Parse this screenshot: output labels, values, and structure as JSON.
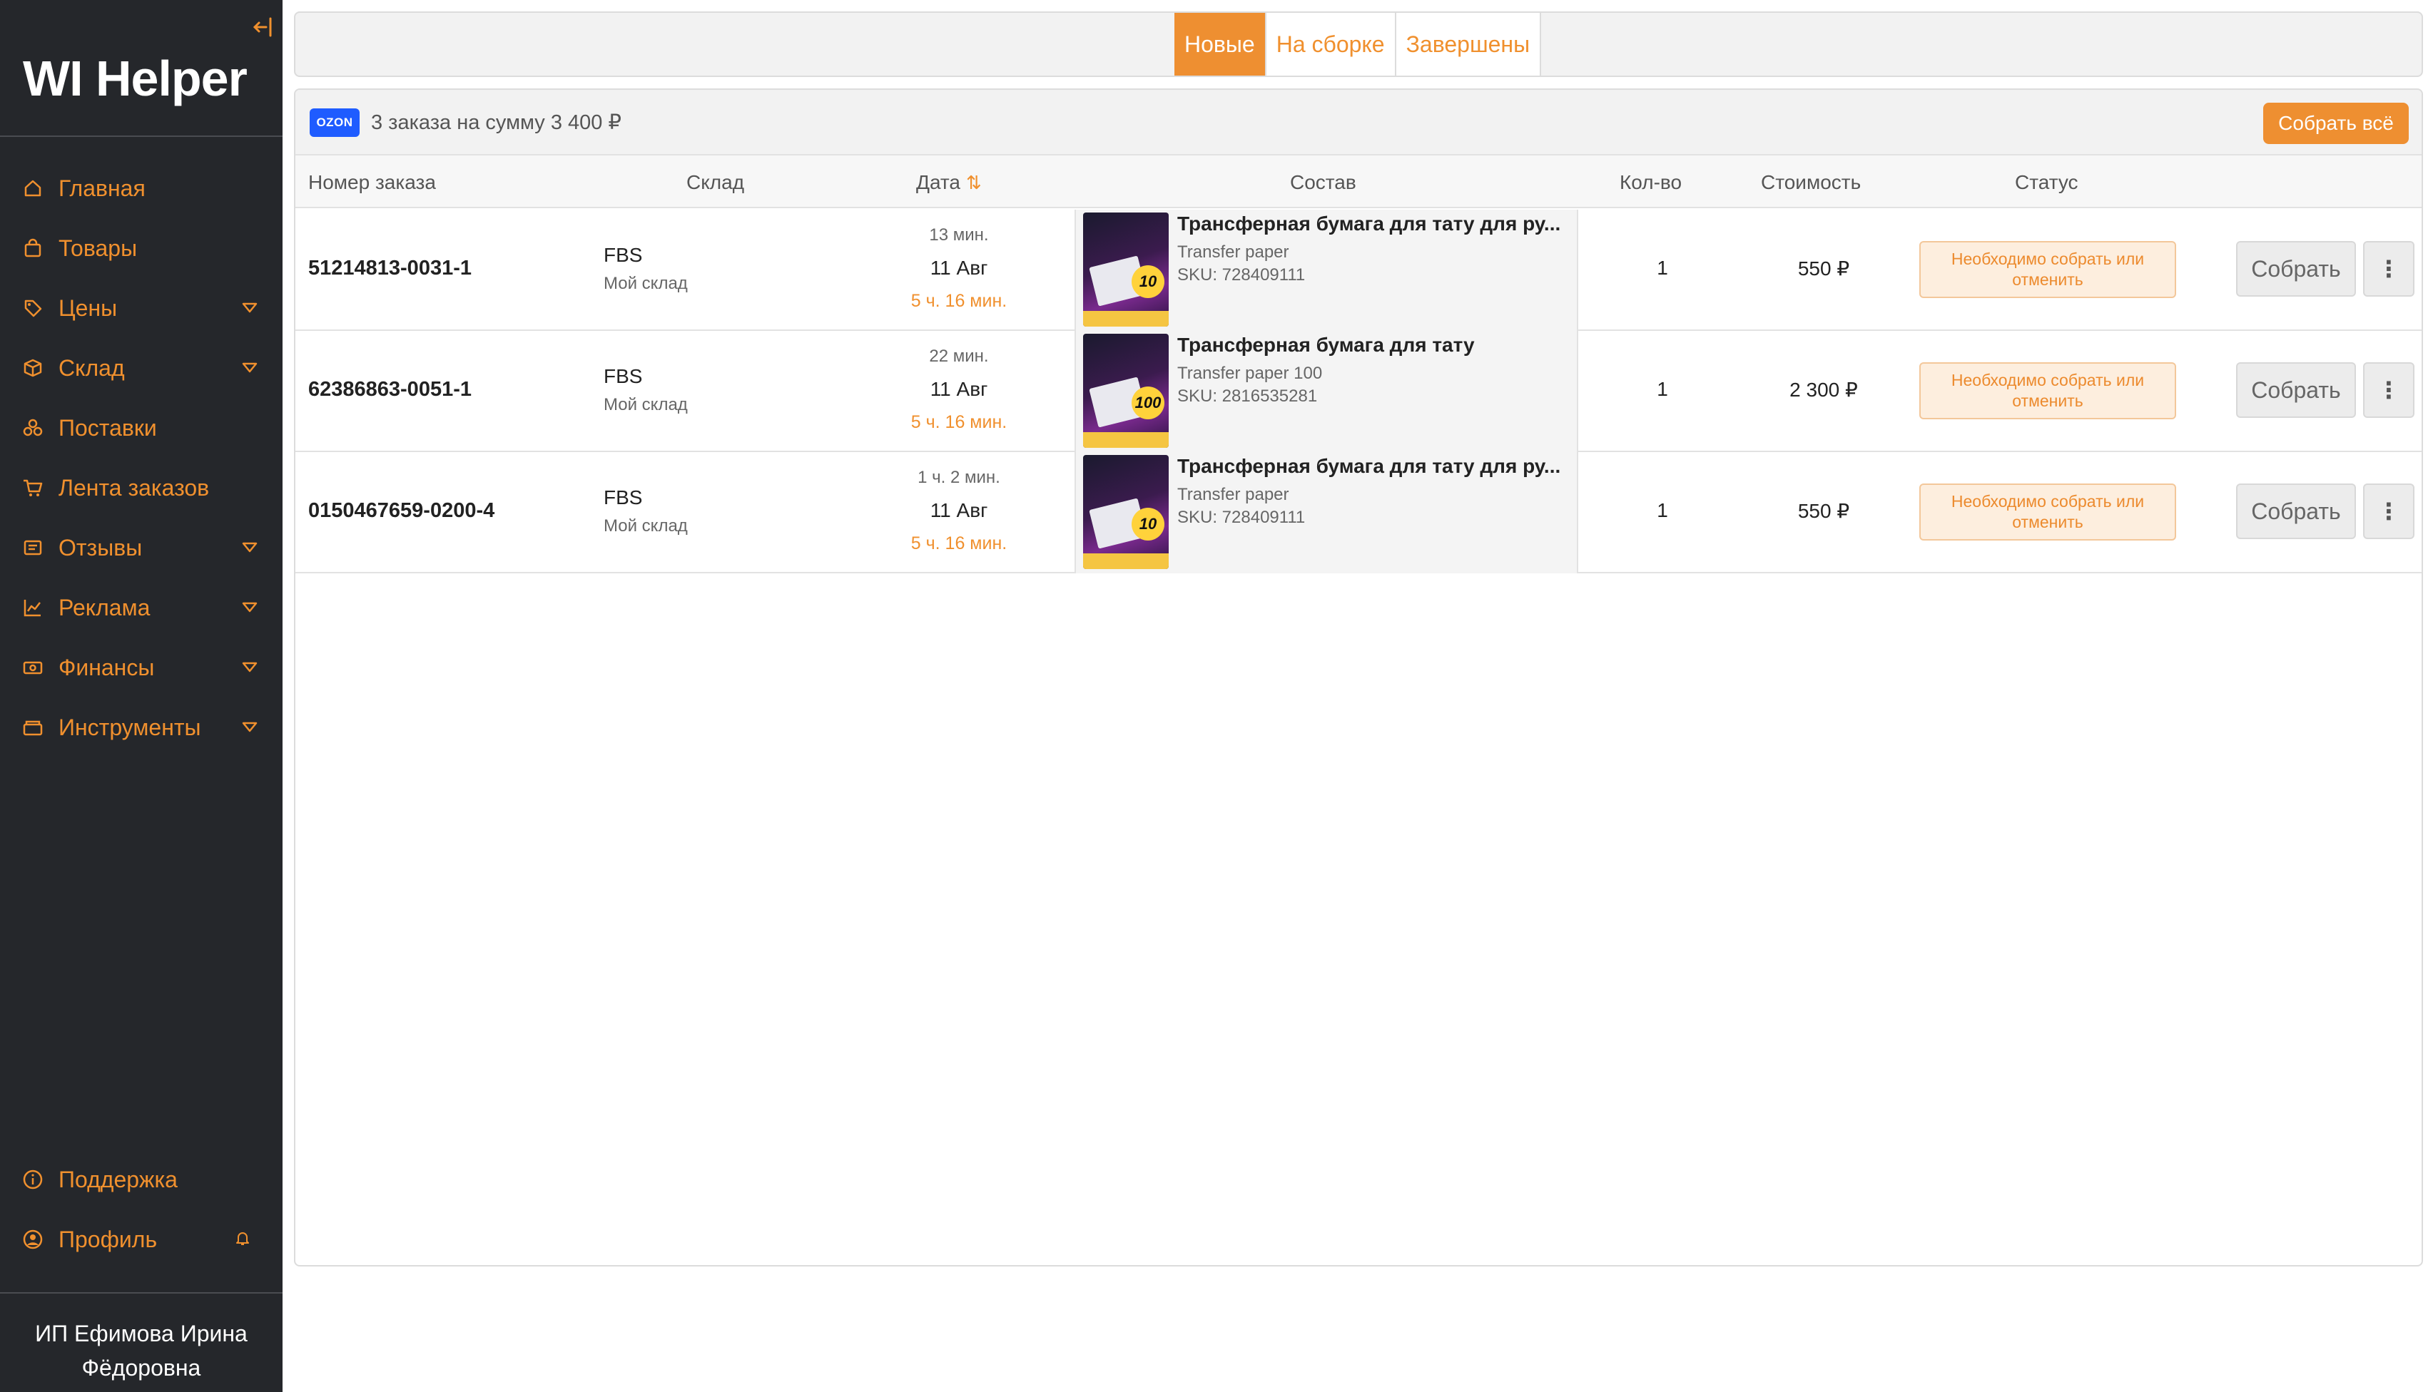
{
  "app": {
    "logo": "WI Helper",
    "collapse_icon": "collapse-left-icon"
  },
  "sidebar": {
    "items": [
      {
        "label": "Главная",
        "icon": "home-icon",
        "has_submenu": false
      },
      {
        "label": "Товары",
        "icon": "bag-icon",
        "has_submenu": false
      },
      {
        "label": "Цены",
        "icon": "tag-icon",
        "has_submenu": true
      },
      {
        "label": "Склад",
        "icon": "box-icon",
        "has_submenu": true
      },
      {
        "label": "Поставки",
        "icon": "boxes-icon",
        "has_submenu": false
      },
      {
        "label": "Лента заказов",
        "icon": "cart-icon",
        "has_submenu": false
      },
      {
        "label": "Отзывы",
        "icon": "reviews-icon",
        "has_submenu": true
      },
      {
        "label": "Реклама",
        "icon": "chart-line-icon",
        "has_submenu": true
      },
      {
        "label": "Финансы",
        "icon": "money-icon",
        "has_submenu": true
      },
      {
        "label": "Инструменты",
        "icon": "tools-icon",
        "has_submenu": true
      }
    ],
    "bottom_items": [
      {
        "label": "Поддержка",
        "icon": "info-icon"
      },
      {
        "label": "Профиль",
        "icon": "user-circle-icon"
      }
    ],
    "user_name": "ИП Ефимова Ирина Фёдоровна"
  },
  "tabs": [
    {
      "label": "Новые",
      "active": true
    },
    {
      "label": "На сборке",
      "active": false
    },
    {
      "label": "Завершены",
      "active": false
    }
  ],
  "panel": {
    "marketplace_badge": "OZON",
    "summary": "3 заказа на сумму 3 400 ₽",
    "collect_all_label": "Собрать всё"
  },
  "columns": {
    "order_no": "Номер заказа",
    "warehouse": "Склад",
    "date": "Дата",
    "composition": "Состав",
    "qty": "Кол-во",
    "cost": "Стоимость",
    "status": "Статус"
  },
  "orders": [
    {
      "order_no": "51214813-0031-1",
      "wh_type": "FBS",
      "wh_name": "Мой склад",
      "ago": "13 мин.",
      "date": "11 Авг",
      "time_left": "5 ч. 16 мин.",
      "product_title": "Трансферная бумага для тату для ру...",
      "product_sub": "Transfer paper",
      "sku": "SKU: 728409111",
      "thumb_num": "10",
      "qty": "1",
      "price": "550 ₽",
      "status": "Необходимо собрать или отменить",
      "action": "Собрать"
    },
    {
      "order_no": "62386863-0051-1",
      "wh_type": "FBS",
      "wh_name": "Мой склад",
      "ago": "22 мин.",
      "date": "11 Авг",
      "time_left": "5 ч. 16 мин.",
      "product_title": "Трансферная бумага для тату",
      "product_sub": "Transfer paper 100",
      "sku": "SKU: 2816535281",
      "thumb_num": "100",
      "qty": "1",
      "price": "2 300 ₽",
      "status": "Необходимо собрать или отменить",
      "action": "Собрать"
    },
    {
      "order_no": "0150467659-0200-4",
      "wh_type": "FBS",
      "wh_name": "Мой склад",
      "ago": "1 ч. 2 мин.",
      "date": "11 Авг",
      "time_left": "5 ч. 16 мин.",
      "product_title": "Трансферная бумага для тату для ру...",
      "product_sub": "Transfer paper",
      "sku": "SKU: 728409111",
      "thumb_num": "10",
      "qty": "1",
      "price": "550 ₽",
      "status": "Необходимо собрать или отменить",
      "action": "Собрать"
    }
  ],
  "colors": {
    "accent": "#ee8f31",
    "sidebar_bg": "#25272b",
    "ozon_blue": "#1f5cff",
    "status_bg": "#fdeede"
  }
}
